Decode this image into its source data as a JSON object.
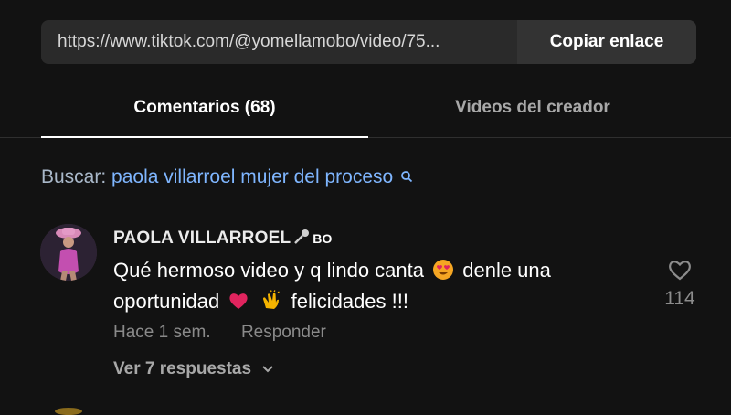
{
  "share": {
    "url": "https://www.tiktok.com/@yomellamobo/video/75...",
    "copy_label": "Copiar enlace"
  },
  "tabs": [
    {
      "label": "Comentarios (68)",
      "active": true
    },
    {
      "label": "Videos del creador",
      "active": false
    }
  ],
  "search": {
    "label": "Buscar:",
    "query": "paola villarroel mujer del proceso"
  },
  "comment": {
    "username": "PAOLA VILLARROEL",
    "badge": "BO",
    "text_part1": "Qué hermoso video y q lindo canta",
    "text_part2": "denle una oportunidad",
    "text_part3": "felicidades !!!",
    "time": "Hace 1 sem.",
    "reply_label": "Responder",
    "view_replies": "Ver 7 respuestas",
    "likes": "114"
  },
  "colors": {
    "background": "#121212",
    "search_query": "#7fb6ff",
    "muted": "#8a8a8a"
  },
  "icons": [
    "search-icon",
    "microphone-icon",
    "heart-eyes-emoji",
    "heart-emoji",
    "clapping-hands-emoji",
    "heart-outline-icon",
    "chevron-down-icon"
  ]
}
